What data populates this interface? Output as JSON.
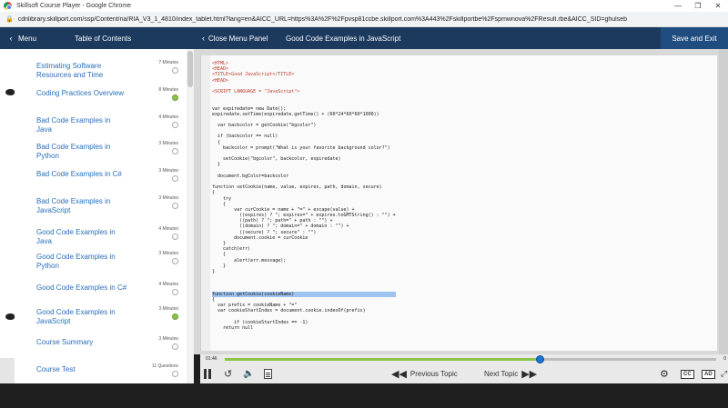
{
  "browser": {
    "window_title": "Skillsoft Course Player - Google Chrome",
    "url": "cdnlibrary.skillport.com/ssp/Content/ria/RIA_V3_1_4810/index_tablet.html?lang=en&AICC_URL=https%3A%2F%2Fpvsp81ccbe.skillport.com%3A443%2Fskillportbe%2Fspmwnova%2FResult.rbe&AICC_SID=ghulseb",
    "lock_icon": "lock-icon",
    "controls": [
      "—",
      "❐",
      "✕"
    ]
  },
  "header": {
    "back_icon": "‹",
    "menu_label": "Menu",
    "toc_label": "Table of Contents",
    "close_panel_icon": "‹",
    "close_panel_label": "Close Menu Panel",
    "lesson_title": "Good Code Examples in JavaScript",
    "save_exit_label": "Save and Exit",
    "accent": "#1b3a5e"
  },
  "toc": {
    "items": [
      {
        "label": "Estimating Software Resources and Time",
        "duration": "7 Minutes",
        "status": "not-started"
      },
      {
        "label": "Coding Practices Overview",
        "duration": "8 Minutes",
        "status": "completed"
      },
      {
        "label": "Bad Code Examples in Java",
        "duration": "4 Minutes",
        "status": "not-started"
      },
      {
        "label": "Bad Code Examples in Python",
        "duration": "3 Minutes",
        "status": "not-started"
      },
      {
        "label": "Bad Code Examples in C#",
        "duration": "3 Minutes",
        "status": "not-started"
      },
      {
        "label": "Bad Code Examples in JavaScript",
        "duration": "3 Minutes",
        "status": "not-started"
      },
      {
        "label": "Good Code Examples in Java",
        "duration": "4 Minutes",
        "status": "not-started"
      },
      {
        "label": "Good Code Examples in Python",
        "duration": "3 Minutes",
        "status": "not-started"
      },
      {
        "label": "Good Code Examples in C#",
        "duration": "4 Minutes",
        "status": "not-started"
      },
      {
        "label": "Good Code Examples in JavaScript",
        "duration": "3 Minutes",
        "status": "completed"
      },
      {
        "label": "Course Summary",
        "duration": "3 Minutes",
        "status": "not-started"
      },
      {
        "label": "Course Test",
        "duration": "11 Questions",
        "status": "not-started"
      }
    ]
  },
  "code": {
    "lines": [
      "<HTML>",
      "<HEAD>",
      "<TITLE>Good JavaScript</TITLE>",
      "<HEAD>",
      "",
      "<SCRIPT LANGUAGE = \"JavaScript\">",
      "",
      "var expiredate= new Date();",
      "expiredate.setTime(expiredate.getTime() + (60*24*60*60*1000))",
      "",
      "  var backcolor = getCookie(\"bgcolor\")",
      "",
      "  if (backcolor == null)",
      "  {",
      "    backcolor = prompt(\"What is your favorite background color?\")",
      "",
      "    setCookie(\"bgcolor\", backcolor, expiredate)",
      "  }",
      "",
      "  document.bgColor=backcolor",
      "",
      "function setCookie(name, value, expires, path, domain, secure)",
      "{",
      "    try",
      "    {",
      "        var curCookie = name + \"=\" + escape(value) +",
      "          ((expires) ? \"; expires=\" + expires.toGMTString() : \"\") +",
      "          ((path) ? \"; path=\" + path : \"\") +",
      "          ((domain) ? \"; domain=\" + domain : \"\") +",
      "          ((secure) ? \"; secure\" : \"\")",
      "        document.cookie = curCookie",
      "    }",
      "    catch(err)",
      "    {",
      "        alert(err.message);",
      "    }",
      "}",
      "",
      "",
      "function getCookie(cookieName)",
      "{",
      "  var prefix = cookieName + \"=\"",
      "  var cookieStartIndex = document.cookie.indexOf(prefix)",
      "",
      "        if (cookieStartIndex == -1)",
      "    return null"
    ],
    "highlighted_line": "function getCookie(cookieName)"
  },
  "player": {
    "time_elapsed": "01:46",
    "time_total": "0",
    "progress": 0.64,
    "prev_label": "Previous Topic",
    "next_label": "Next Topic",
    "cc_label": "CC",
    "ad_label": "AD",
    "progress_color": "#8bc34a",
    "thumb_color": "#1976d2"
  }
}
